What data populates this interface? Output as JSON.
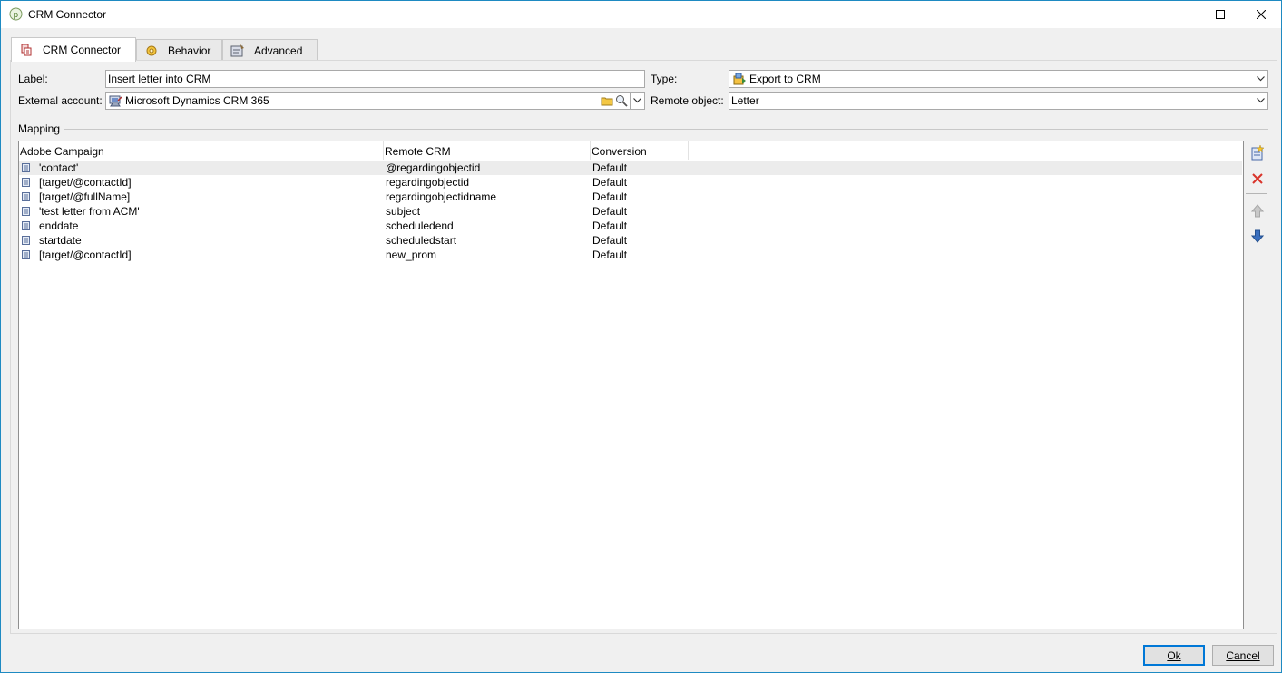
{
  "window": {
    "title": "CRM Connector"
  },
  "tabs": [
    {
      "label": "CRM Connector",
      "icon": "crm-connector-icon",
      "active": true
    },
    {
      "label": "Behavior",
      "icon": "behavior-icon",
      "active": false
    },
    {
      "label": "Advanced",
      "icon": "advanced-icon",
      "active": false
    }
  ],
  "form": {
    "label_caption": "Label:",
    "label_value": "Insert letter into CRM",
    "type_caption": "Type:",
    "type_value": "Export to CRM",
    "external_account_caption": "External account:",
    "external_account_value": "Microsoft Dynamics CRM 365",
    "remote_object_caption": "Remote object:",
    "remote_object_value": "Letter"
  },
  "mapping": {
    "group_label": "Mapping",
    "columns": [
      "Adobe Campaign",
      "Remote CRM",
      "Conversion"
    ],
    "rows": [
      {
        "adobe": "'contact'",
        "remote": "@regardingobjectid",
        "conversion": "Default"
      },
      {
        "adobe": "[target/@contactId]",
        "remote": "regardingobjectid",
        "conversion": "Default"
      },
      {
        "adobe": "[target/@fullName]",
        "remote": "regardingobjectidname",
        "conversion": "Default"
      },
      {
        "adobe": "'test letter from ACM'",
        "remote": "subject",
        "conversion": "Default"
      },
      {
        "adobe": "enddate",
        "remote": "scheduledend",
        "conversion": "Default"
      },
      {
        "adobe": "startdate",
        "remote": "scheduledstart",
        "conversion": "Default"
      },
      {
        "adobe": "[target/@contactId]",
        "remote": "new_prom",
        "conversion": "Default"
      }
    ]
  },
  "buttons": {
    "ok_label": "Ok",
    "cancel_label": "Cancel"
  },
  "colors": {
    "accent": "#0078d7",
    "delete_red": "#d9342b",
    "arrow_blue": "#3a6fbf"
  }
}
